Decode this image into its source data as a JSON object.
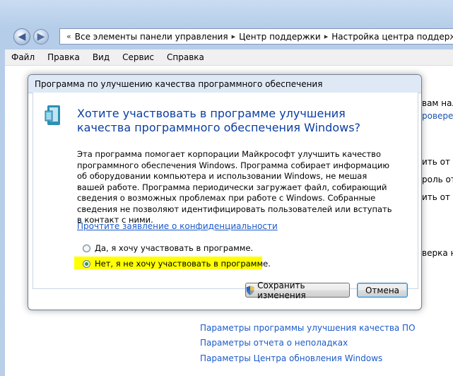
{
  "address": {
    "crumbs": [
      "Все элементы панели управления",
      "Центр поддержки",
      "Настройка центра поддержки"
    ]
  },
  "menu": [
    "Файл",
    "Правка",
    "Вид",
    "Сервис",
    "Справка"
  ],
  "background": {
    "side_texts": [
      "вам нали",
      "роверет",
      "ить от ш",
      "роль от",
      "ить от в",
      "верка на"
    ],
    "bottom_links": [
      "Параметры программы улучшения качества ПО",
      "Параметры отчета о неполадках",
      "Параметры Центра обновления Windows"
    ]
  },
  "dialog": {
    "title": "Программа по улучшению качества программного обеспечения",
    "heading": "Хотите участвовать в программе улучшения качества программного обеспечения Windows?",
    "body": "Эта программа помогает корпорации Майкрософт улучшить качество программного обеспечения Windows. Программа собирает информацию об оборудовании компьютера и использовании Windows, не мешая вашей работе. Программа периодически загружает файл, собирающий сведения о возможных проблемах при работе с Windows. Собранные сведения не позволяют идентифицировать пользователей или вступать в контакт с ними.",
    "privacy_link": "Прочтите заявление о конфиденциальности",
    "option_yes": "Да, я хочу участвовать в программе.",
    "option_no": "Нет, я не хочу участвовать в программе.",
    "selected": "option_no",
    "save_label": "Сохранить изменения",
    "cancel_label": "Отмена"
  }
}
